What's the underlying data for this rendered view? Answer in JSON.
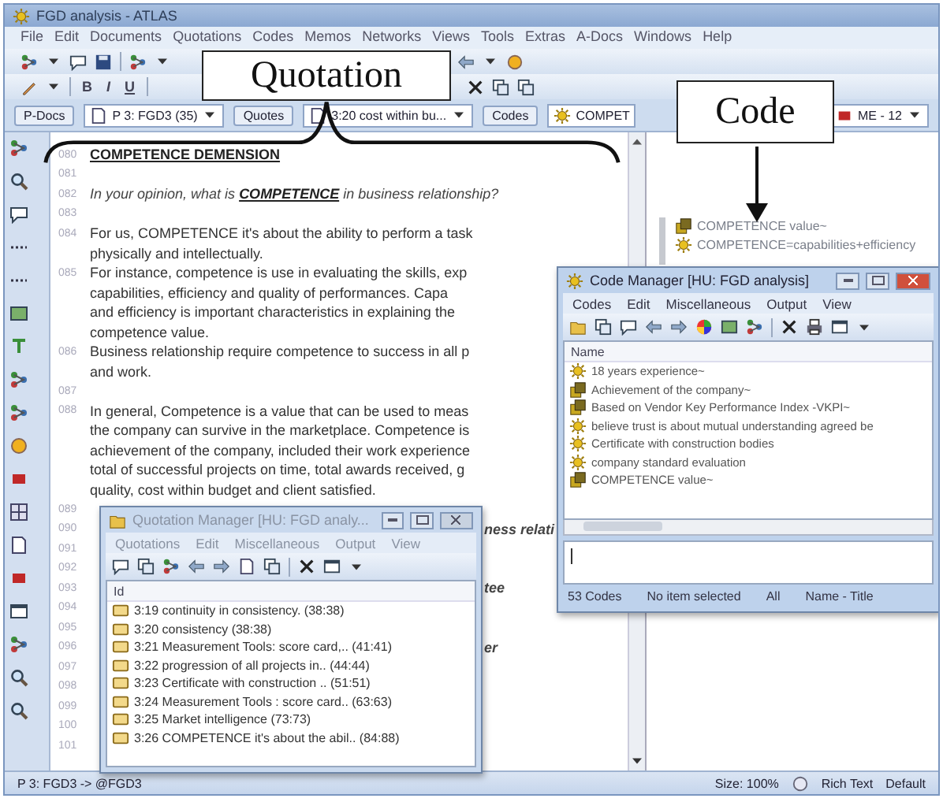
{
  "window": {
    "title": "FGD analysis - ATLAS"
  },
  "menu": [
    "File",
    "Edit",
    "Documents",
    "Quotations",
    "Codes",
    "Memos",
    "Networks",
    "Views",
    "Tools",
    "Extras",
    "A-Docs",
    "Windows",
    "Help"
  ],
  "format_buttons": [
    "B",
    "I",
    "U"
  ],
  "doc_bar": [
    {
      "kind": "button",
      "label": "P-Docs"
    },
    {
      "kind": "combo",
      "label": "P 3: FGD3 (35)"
    },
    {
      "kind": "button",
      "label": "Quotes"
    },
    {
      "kind": "combo",
      "label": "3:20 cost within bu..."
    },
    {
      "kind": "button",
      "label": "Codes"
    },
    {
      "kind": "code-combo",
      "label": "COMPET"
    },
    {
      "kind": "memo-combo",
      "label": "ME - 12"
    }
  ],
  "document": {
    "lines": [
      {
        "number": "080",
        "kind": "heading",
        "text": "COMPETENCE DEMENSION"
      },
      {
        "number": "081",
        "kind": "blank"
      },
      {
        "number": "082",
        "kind": "question",
        "text": "In your opinion, what is **COMPETENCE** in business relationship?"
      },
      {
        "number": "083",
        "kind": "blank"
      },
      {
        "number": "084",
        "kind": "text",
        "text": "For us, COMPETENCE it's about the ability to perform a task"
      },
      {
        "kind": "text",
        "text": "physically and intellectually."
      },
      {
        "number": "085",
        "kind": "text",
        "text": "For instance, competence is use in evaluating the skills, exp"
      },
      {
        "kind": "text",
        "text": "capabilities, efficiency and quality of performances. Capa"
      },
      {
        "kind": "text",
        "text": "and efficiency is important characteristics in explaining the"
      },
      {
        "kind": "text",
        "text": "competence value."
      },
      {
        "number": "086",
        "kind": "text",
        "text": "Business relationship require competence to success in all p"
      },
      {
        "kind": "text",
        "text": "and work."
      },
      {
        "number": "087",
        "kind": "blank"
      },
      {
        "number": "088",
        "kind": "text",
        "text": "In general, Competence is a value that can be used to meas"
      },
      {
        "kind": "text",
        "text": "the company can survive in the marketplace. Competence is"
      },
      {
        "kind": "text",
        "text": "achievement of the company, included their work experience"
      },
      {
        "kind": "text",
        "text": "total of successful projects on time, total awards received, g"
      },
      {
        "kind": "text",
        "text": "quality, cost within budget and client satisfied."
      },
      {
        "number": "089",
        "kind": "blank"
      },
      {
        "number": "090",
        "kind": "fragment",
        "text": "ness relati"
      },
      {
        "number": "091",
        "kind": "blank"
      },
      {
        "number": "092",
        "kind": "blank"
      },
      {
        "number": "093",
        "kind": "fragment",
        "text": "tee"
      },
      {
        "number": "094",
        "kind": "blank"
      },
      {
        "number": "095",
        "kind": "blank"
      },
      {
        "number": "096",
        "kind": "fragment",
        "text": "er"
      },
      {
        "number": "097",
        "kind": "blank"
      },
      {
        "number": "098",
        "kind": "blank"
      },
      {
        "number": "099",
        "kind": "blank"
      },
      {
        "number": "100",
        "kind": "blank"
      },
      {
        "number": "101",
        "kind": "blank"
      }
    ]
  },
  "code_margin": [
    {
      "label": "COMPETENCE value~",
      "commented": true
    },
    {
      "label": "COMPETENCE=capabilities+efficiency",
      "commented": false
    }
  ],
  "code_manager": {
    "title": "Code Manager [HU: FGD analysis]",
    "active": true,
    "menu": [
      "Codes",
      "Edit",
      "Miscellaneous",
      "Output",
      "View"
    ],
    "column": "Name",
    "items": [
      {
        "label": "18 years experience~",
        "commented": false
      },
      {
        "label": "Achievement of the company~",
        "commented": true
      },
      {
        "label": "Based on Vendor Key Performance Index -VKPI~",
        "commented": true
      },
      {
        "label": "believe trust is about mutual understanding agreed be",
        "commented": false
      },
      {
        "label": "Certificate with construction bodies",
        "commented": false
      },
      {
        "label": "company standard evaluation",
        "commented": false
      },
      {
        "label": "COMPETENCE value~",
        "commented": true
      }
    ],
    "status": [
      "53 Codes",
      "No item selected",
      "All",
      "Name - Title"
    ]
  },
  "quotation_manager": {
    "title": "Quotation Manager [HU: FGD analy...",
    "active": false,
    "menu": [
      "Quotations",
      "Edit",
      "Miscellaneous",
      "Output",
      "View"
    ],
    "column": "Id",
    "items": [
      "3:19 continuity in consistency. (38:38)",
      "3:20 consistency (38:38)",
      "3:21 Measurement Tools: score card,.. (41:41)",
      "3:22 progression of all projects in.. (44:44)",
      "3:23 Certificate with construction .. (51:51)",
      "3:24 Measurement Tools : score card.. (63:63)",
      "3:25 Market intelligence (73:73)",
      "3:26 COMPETENCE it's about the abil.. (84:88)"
    ]
  },
  "status_bar": {
    "left": "P 3: FGD3 -> @FGD3",
    "size": "Size: 100%",
    "format": "Rich Text",
    "style": "Default"
  },
  "annotations": [
    {
      "kind": "brace",
      "label": "Quotation"
    },
    {
      "kind": "arrow",
      "label": "Code"
    }
  ]
}
